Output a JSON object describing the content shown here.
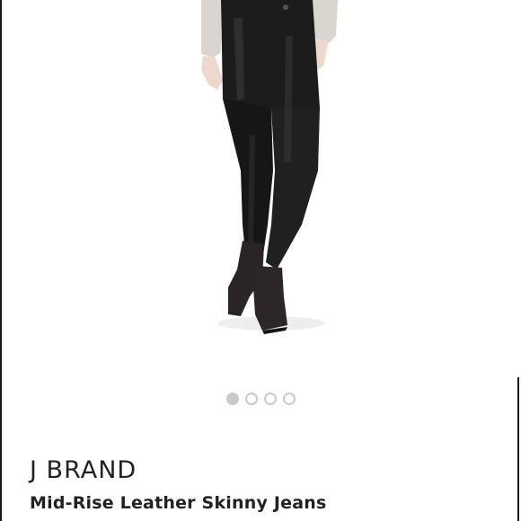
{
  "product": {
    "brand": "J BRAND",
    "title": "Mid-Rise Leather Skinny Jeans",
    "image_description_icon": "product-photo"
  },
  "carousel": {
    "total": 4,
    "active_index": 0
  },
  "colors": {
    "background": "#ffffff",
    "text": "#222222",
    "dot": "#c9c9c9"
  }
}
